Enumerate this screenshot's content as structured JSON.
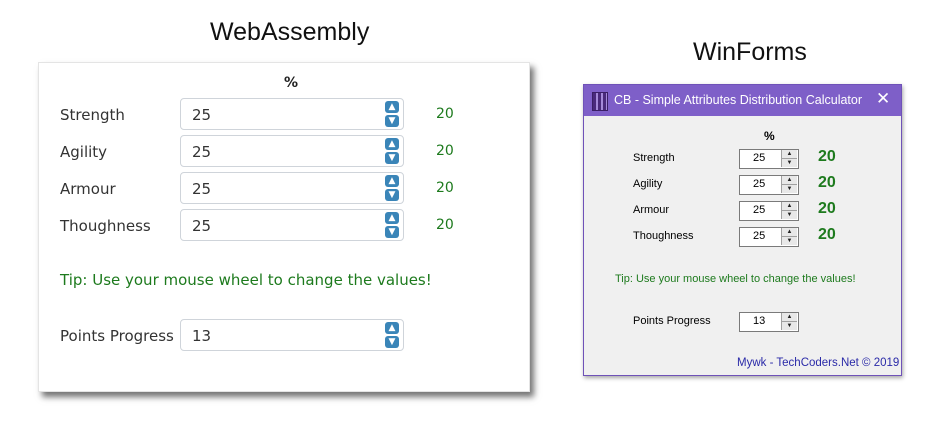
{
  "captions": {
    "wasm": "WebAssembly",
    "winforms": "WinForms"
  },
  "wasm": {
    "percent_header": "%",
    "attributes": [
      {
        "label": "Strength",
        "value": "25",
        "points": "20"
      },
      {
        "label": "Agility",
        "value": "25",
        "points": "20"
      },
      {
        "label": "Armour",
        "value": "25",
        "points": "20"
      },
      {
        "label": "Thoughness",
        "value": "25",
        "points": "20"
      }
    ],
    "tip": "Tip: Use your mouse wheel to change the values!",
    "progress": {
      "label": "Points Progress",
      "value": "13"
    }
  },
  "winforms": {
    "title": "CB - Simple Attributes Distribution Calculator",
    "close_glyph": "✕",
    "percent_header": "%",
    "attributes": [
      {
        "label": "Strength",
        "value": "25",
        "points": "20"
      },
      {
        "label": "Agility",
        "value": "25",
        "points": "20"
      },
      {
        "label": "Armour",
        "value": "25",
        "points": "20"
      },
      {
        "label": "Thoughness",
        "value": "25",
        "points": "20"
      }
    ],
    "tip": "Tip: Use your mouse wheel to change the values!",
    "progress": {
      "label": "Points Progress",
      "value": "13"
    },
    "footer": "Mywk - TechCoders.Net © 2019"
  },
  "glyphs": {
    "up": "▲",
    "down": "▼",
    "up_icon": "chevron-up-icon",
    "down_icon": "chevron-down-icon"
  },
  "colors": {
    "accent_green": "#1d7a1d",
    "spin_button_blue": "#3a85b8",
    "titlebar_purple": "#7e5fc8",
    "footer_blue": "#2a2aa8"
  }
}
